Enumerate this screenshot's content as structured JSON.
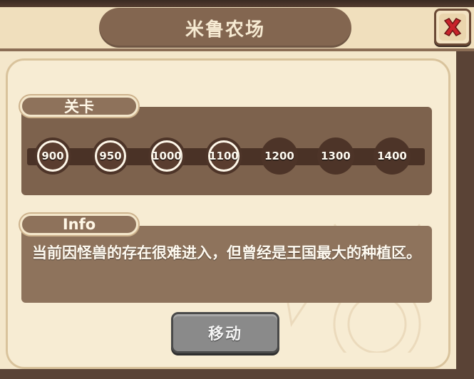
{
  "window": {
    "title": "米鲁农场"
  },
  "sections": {
    "levels_label": "关卡",
    "info_label": "Info"
  },
  "levels": [
    {
      "label": "900",
      "completed": true
    },
    {
      "label": "950",
      "completed": true
    },
    {
      "label": "1000",
      "completed": true
    },
    {
      "label": "1100",
      "completed": true
    },
    {
      "label": "1200",
      "completed": false
    },
    {
      "label": "1300",
      "completed": false
    },
    {
      "label": "1400",
      "completed": false
    }
  ],
  "info": {
    "text": "当前因怪兽的存在很难进入，但曾经是王国最大的种植区。"
  },
  "actions": {
    "move_label": "移动"
  },
  "icons": {
    "close": "close-icon"
  },
  "colors": {
    "close_x": "#c8232a",
    "panel_bg": "#f4e7cb",
    "brown": "#836650"
  }
}
